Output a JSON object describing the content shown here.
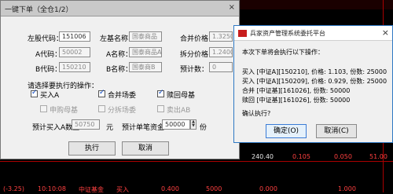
{
  "order_dialog": {
    "title": "一键下单（全仓1/2）",
    "close": "×",
    "stock_code_label": "左股代码：",
    "stock_code_value": "151006",
    "left_name_label": "左基名称：",
    "left_name_value": "国泰商品",
    "merge_label": "合并价格：",
    "merge_value": "1.3250",
    "a_code_label": "A代码：",
    "a_code_value": "50002",
    "a_name_label": "A名称：",
    "a_name_value": "国泰商品A",
    "split_label": "拆分价格：",
    "split_value": "1.2400",
    "b_code_label": "B代码：",
    "b_code_value": "150210",
    "b_name_label": "B名称：",
    "b_name_value": "国泰商B",
    "count_label": "预计数：",
    "count_value": "0",
    "section_label": "请选择要执行的操作：",
    "checkboxes": [
      {
        "label": "买入A",
        "checked": true,
        "enabled": true
      },
      {
        "label": "合并场委",
        "checked": true,
        "enabled": true
      },
      {
        "label": "赎回母基",
        "checked": true,
        "enabled": true
      },
      {
        "label": "申购母基",
        "checked": false,
        "enabled": false
      },
      {
        "label": "分拆场委",
        "checked": false,
        "enabled": false
      },
      {
        "label": "卖出AB",
        "checked": false,
        "enabled": false
      }
    ],
    "amount_label": "预计买入A数量：",
    "amount_value": "50750",
    "amount_unit": "元",
    "funds_label": "预计单笔资金：",
    "funds_value": "50000",
    "funds_unit": "份",
    "ok_label": "执行",
    "cancel_label": "取消"
  },
  "confirm_dialog": {
    "title": "兵家资产管理系统委托平台",
    "close": "×",
    "intro": "本次下单将会执行以下操作：",
    "lines": [
      "买入 [中证A][150210], 价格: 1.103, 份数: 25000",
      "买入 [中证A][150209], 价格: 0.929, 份数: 25000",
      "合并 [中证基][161026], 份数: 50000",
      "赎回 [中证基][161026], 份数: 50000"
    ],
    "question": "确认执行?",
    "ok_label": "确定(O)",
    "cancel_label": "取消(C)"
  },
  "background_table": {
    "row1": [
      "240.40",
      "0.105",
      "0.050",
      "51.00"
    ],
    "row2": [
      "(-3.25)",
      "10:10:08",
      "中证基金",
      "买入",
      "0.400",
      "5000",
      "0.000",
      "1.000"
    ]
  }
}
